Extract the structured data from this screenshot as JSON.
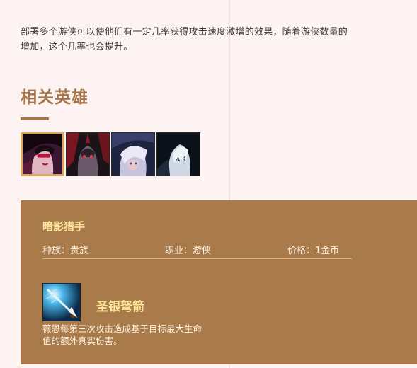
{
  "trait": {
    "description": "部署多个游侠可以使他们有一定几率获得攻击速度激增的效果，随着游侠数量的增加，这个几率也会提升。"
  },
  "related": {
    "title": "相关英雄",
    "heroes": [
      {
        "icon": "vayne-portrait-icon",
        "selected": true
      },
      {
        "icon": "varus-portrait-icon",
        "selected": false
      },
      {
        "icon": "ashe-portrait-icon",
        "selected": false
      },
      {
        "icon": "kindred-portrait-icon",
        "selected": false
      }
    ]
  },
  "detail": {
    "name": "暗影猎手",
    "race": "种族：贵族",
    "class": "职业：游侠",
    "price": "价格：1金币",
    "skill": {
      "icon": "silver-bolts-icon",
      "name": "圣银弩箭",
      "description": "薇恩每第三次攻击造成基于目标最大生命值的额外真实伤害。"
    }
  },
  "colors": {
    "page_bg": "#fdf3f2",
    "accent": "#a4754a",
    "panel_bg": "#a97a4a",
    "gold_text": "#ffe79a",
    "selected_border": "#d8a95c"
  }
}
